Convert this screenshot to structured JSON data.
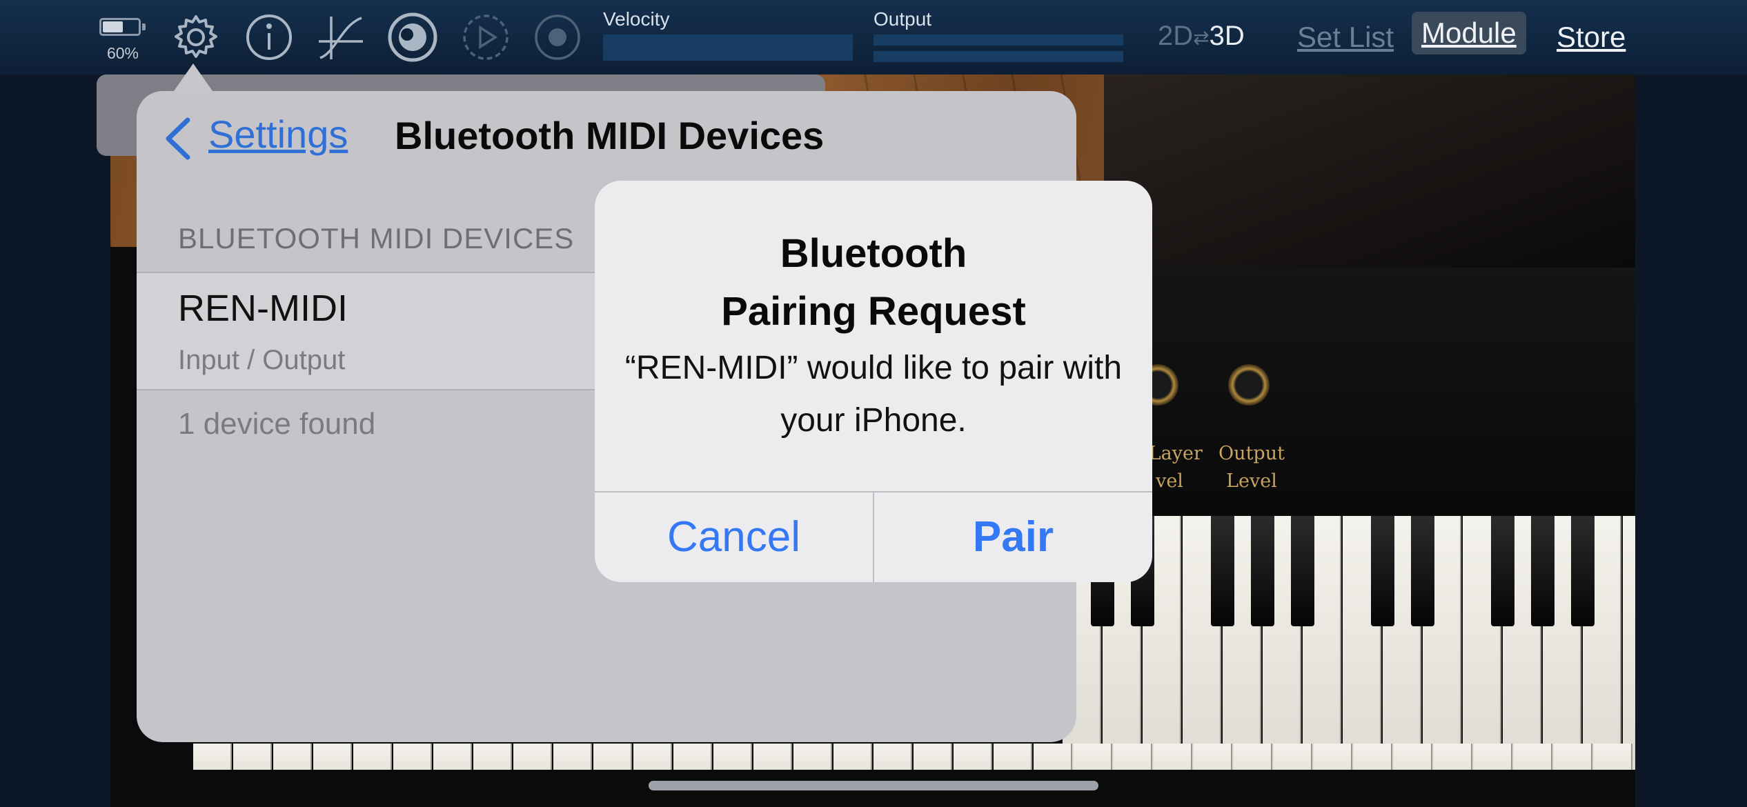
{
  "toolbar": {
    "battery_percent": "60%",
    "battery_level": 0.6,
    "velocity_label": "Velocity",
    "output_label": "Output",
    "mode_2d": "2D",
    "mode_swap": "⇄",
    "mode_3d": "3D",
    "links": {
      "set_list": "Set List",
      "module": "Module",
      "store": "Store"
    },
    "icons": [
      "settings-icon",
      "info-icon",
      "velocity-curve-icon",
      "volume-knob-icon",
      "playback-icon",
      "record-icon"
    ]
  },
  "piano": {
    "knob_labels": [
      "/ Layer\nvel",
      "Output\nLevel"
    ]
  },
  "popover": {
    "back_label": "Settings",
    "title": "Bluetooth MIDI Devices",
    "section_header": "BLUETOOTH MIDI DEVICES",
    "device": {
      "name": "REN-MIDI",
      "subtitle": "Input / Output"
    },
    "found_text": "1 device found"
  },
  "alert": {
    "title": "Bluetooth\nPairing Request",
    "message": "“REN-MIDI” would like to pair with your iPhone.",
    "cancel_label": "Cancel",
    "pair_label": "Pair"
  },
  "colors": {
    "accent": "#3478f6",
    "link_blue": "#2f6fd6",
    "toolbar_bg": "#0d1f35"
  }
}
